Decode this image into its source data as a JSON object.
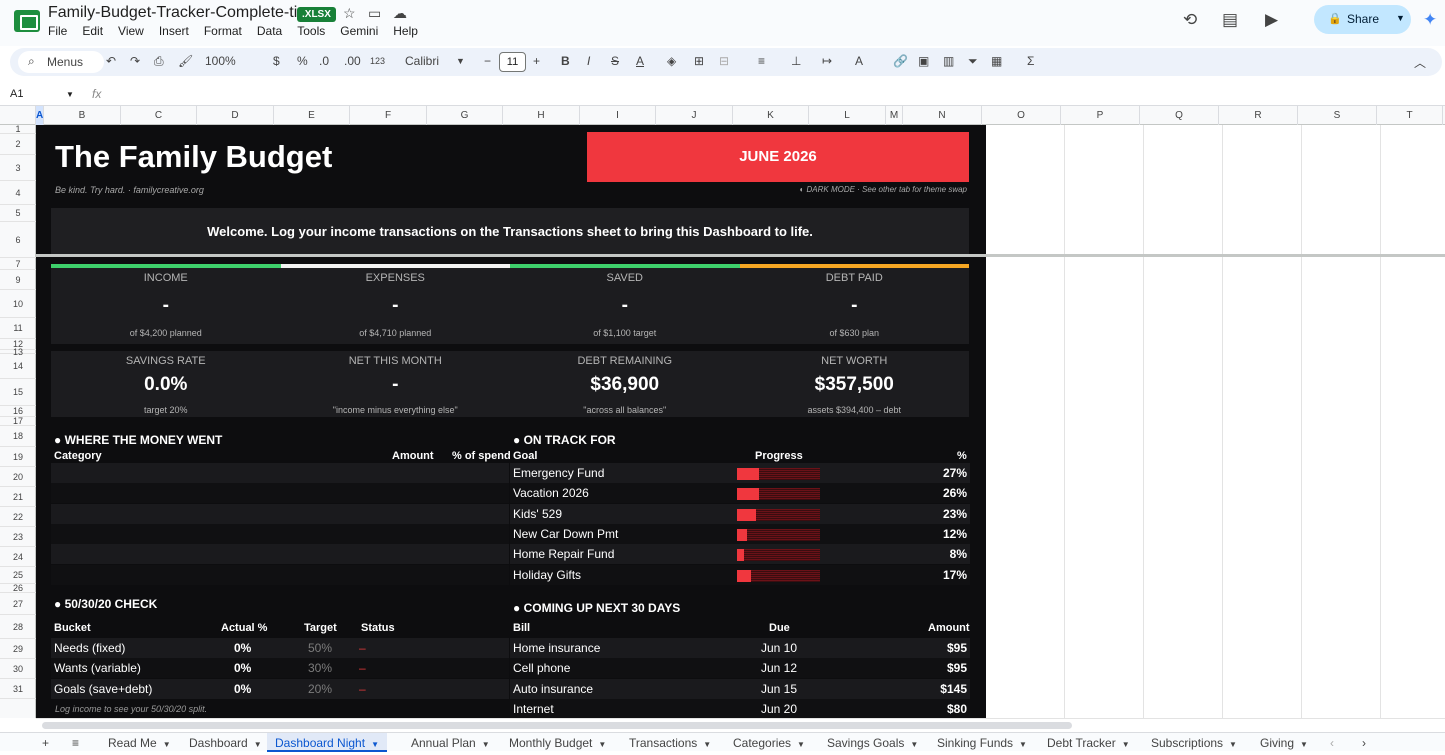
{
  "app": {
    "doc_title": "Family-Budget-Tracker-Complete-tier",
    "badge": ".XLSX",
    "menu": [
      "File",
      "Edit",
      "View",
      "Insert",
      "Format",
      "Data",
      "Tools",
      "Gemini",
      "Help"
    ],
    "share_label": "Share"
  },
  "toolbar": {
    "search_label": "Menus",
    "zoom": "100%",
    "currency": "$",
    "percent": "%",
    "dec_less": ".0",
    "dec_more": ".00",
    "format_123": "123",
    "font": "Calibri",
    "font_size": "11"
  },
  "formula": {
    "cell_ref": "A1",
    "fx": "fx"
  },
  "columns": [
    "A",
    "B",
    "C",
    "D",
    "E",
    "F",
    "G",
    "H",
    "I",
    "J",
    "K",
    "L",
    "M",
    "N",
    "O",
    "P",
    "Q",
    "R",
    "S",
    "T"
  ],
  "rows": [
    "1",
    "2",
    "3",
    "4",
    "5",
    "6",
    "7",
    "9",
    "10",
    "11",
    "12",
    "13",
    "14",
    "15",
    "16",
    "17",
    "18",
    "19",
    "20",
    "21",
    "22",
    "23",
    "24",
    "25",
    "26",
    "27",
    "28",
    "29",
    "30",
    "31"
  ],
  "header": {
    "title": "The Family Budget",
    "month": "JUNE 2026",
    "tagline": "Be kind. Try hard.  ·  familycreative.org",
    "mode_note": "◐ DARK MODE · See other tab for theme swap",
    "welcome": "Welcome. Log your income transactions on the Transactions sheet to bring this Dashboard to life."
  },
  "kpis1": [
    {
      "label": "INCOME",
      "value": "-",
      "sub": "of $4,200 planned",
      "color": "#3ecf6b"
    },
    {
      "label": "EXPENSES",
      "value": "-",
      "sub": "of $4,710 planned",
      "color": "#f2f2f2"
    },
    {
      "label": "SAVED",
      "value": "-",
      "sub": "of $1,100 target",
      "color": "#3ecf6b"
    },
    {
      "label": "DEBT PAID",
      "value": "-",
      "sub": "of $630 plan",
      "color": "#f5a623"
    }
  ],
  "kpis2": [
    {
      "label": "SAVINGS RATE",
      "value": "0.0%",
      "sub": "target 20%"
    },
    {
      "label": "NET THIS MONTH",
      "value": "-",
      "sub": "\"income minus everything else\""
    },
    {
      "label": "DEBT REMAINING",
      "value": "$36,900",
      "sub": "\"across all balances\""
    },
    {
      "label": "NET WORTH",
      "value": "$357,500",
      "sub": "assets $394,400 – debt"
    }
  ],
  "money": {
    "title": "● WHERE THE MONEY WENT",
    "headers": [
      "Category",
      "Amount",
      "% of spend"
    ],
    "rows": 6
  },
  "ontrack": {
    "title": "● ON TRACK FOR",
    "headers": [
      "Goal",
      "Progress",
      "%"
    ],
    "rows": [
      {
        "goal": "Emergency Fund",
        "pct": "27%",
        "frac": 0.27
      },
      {
        "goal": "Vacation 2026",
        "pct": "26%",
        "frac": 0.26
      },
      {
        "goal": "Kids' 529",
        "pct": "23%",
        "frac": 0.23
      },
      {
        "goal": "New Car Down Pmt",
        "pct": "12%",
        "frac": 0.12
      },
      {
        "goal": "Home Repair Fund",
        "pct": "8%",
        "frac": 0.08
      },
      {
        "goal": "Holiday Gifts",
        "pct": "17%",
        "frac": 0.17
      }
    ]
  },
  "check": {
    "title": "● 50/30/20 CHECK",
    "headers": [
      "Bucket",
      "Actual %",
      "Target",
      "Status"
    ],
    "rows": [
      {
        "bucket": "Needs (fixed)",
        "actual": "0%",
        "target": "50%",
        "status": "–"
      },
      {
        "bucket": "Wants (variable)",
        "actual": "0%",
        "target": "30%",
        "status": "–"
      },
      {
        "bucket": "Goals (save+debt)",
        "actual": "0%",
        "target": "20%",
        "status": "–"
      }
    ],
    "note": "Log income to see your 50/30/20 split."
  },
  "coming": {
    "title": "● COMING UP NEXT 30 DAYS",
    "headers": [
      "Bill",
      "Due",
      "Amount"
    ],
    "rows": [
      {
        "bill": "Home insurance",
        "due": "Jun 10",
        "amount": "$95"
      },
      {
        "bill": "Cell phone",
        "due": "Jun 12",
        "amount": "$95"
      },
      {
        "bill": "Auto insurance",
        "due": "Jun 15",
        "amount": "$145"
      },
      {
        "bill": "Internet",
        "due": "Jun 20",
        "amount": "$80"
      }
    ]
  },
  "tabs": [
    "Read Me",
    "Dashboard",
    "Dashboard Night",
    "Annual Plan",
    "Monthly Budget",
    "Transactions",
    "Categories",
    "Savings Goals",
    "Sinking Funds",
    "Debt Tracker",
    "Subscriptions",
    "Giving"
  ],
  "active_tab": "Dashboard Night"
}
